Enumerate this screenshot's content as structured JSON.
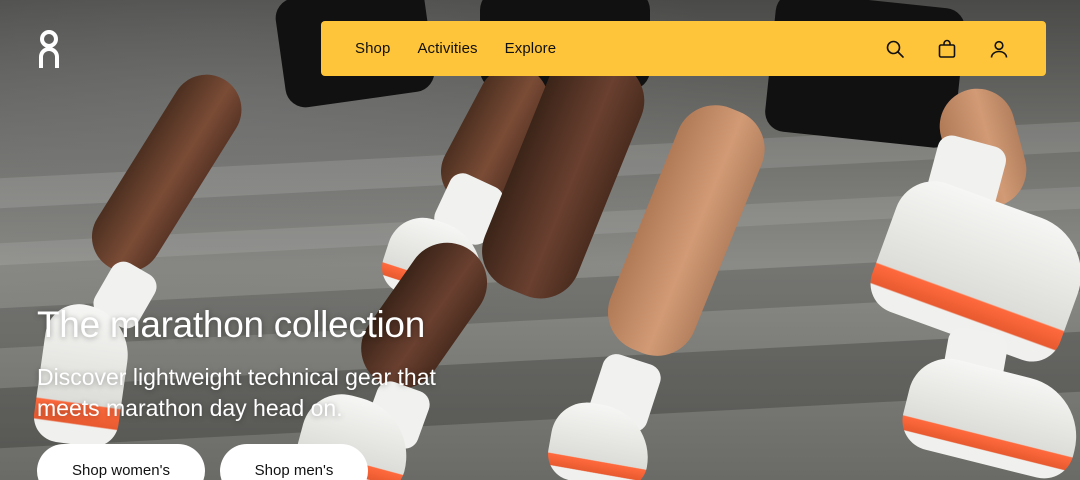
{
  "brand": {
    "logo_icon": "on-logo-icon"
  },
  "nav": {
    "links": [
      {
        "label": "Shop"
      },
      {
        "label": "Activities"
      },
      {
        "label": "Explore"
      }
    ],
    "icons": [
      "search-icon",
      "bag-icon",
      "account-icon"
    ],
    "background": "#ffc53a"
  },
  "hero": {
    "headline": "The marathon collection",
    "subline": "Discover lightweight technical gear that meets marathon day head on.",
    "buttons": [
      {
        "label": "Shop women's"
      },
      {
        "label": "Shop men's"
      }
    ]
  }
}
